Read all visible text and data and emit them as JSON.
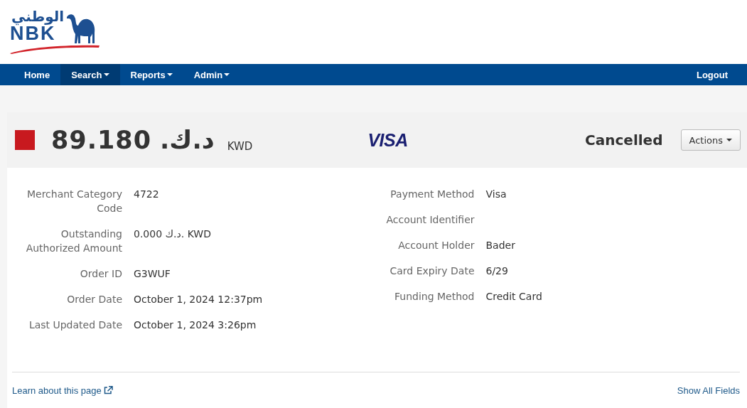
{
  "logo": {
    "arabic": "الوطني",
    "latin": "NBK"
  },
  "nav": {
    "items": [
      {
        "label": "Home",
        "dropdown": false,
        "selected": false
      },
      {
        "label": "Search",
        "dropdown": true,
        "selected": true
      },
      {
        "label": "Reports",
        "dropdown": true,
        "selected": false
      },
      {
        "label": "Admin",
        "dropdown": true,
        "selected": false
      }
    ],
    "logout": "Logout"
  },
  "summary": {
    "amount": "89.180",
    "currency_symbol": "د.ك.",
    "currency": "KWD",
    "card_brand": "VISA",
    "status": {
      "label": "Cancelled",
      "color": "#c8191f"
    },
    "actions": "Actions"
  },
  "details": {
    "left": [
      {
        "label": "Merchant Category Code",
        "value": "4722"
      },
      {
        "label": "Outstanding Authorized Amount",
        "value": "0.000 د.ك. KWD"
      },
      {
        "label": "Order ID",
        "value": "G3WUF"
      },
      {
        "label": "Order Date",
        "value": "October 1, 2024 12:37pm"
      },
      {
        "label": "Last Updated Date",
        "value": "October 1, 2024 3:26pm"
      }
    ],
    "right": [
      {
        "label": "Payment Method",
        "value": "Visa"
      },
      {
        "label": "Account Identifier"
      },
      {
        "label": "Account Holder",
        "value": "Bader"
      },
      {
        "label": "Card Expiry Date",
        "value": "6/29"
      },
      {
        "label": "Funding Method",
        "value": "Credit Card"
      }
    ]
  },
  "footer": {
    "learn_link": "Learn about this page",
    "show_all": "Show All Fields"
  }
}
